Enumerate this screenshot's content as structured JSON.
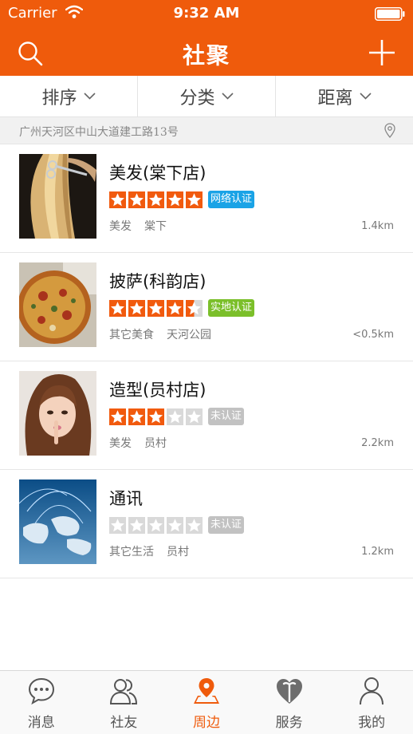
{
  "status_bar": {
    "carrier": "Carrier",
    "time": "9:32 AM"
  },
  "nav": {
    "title": "社聚",
    "left_icon": "search-icon",
    "right_icon": "add-icon"
  },
  "filters": [
    {
      "label": "排序",
      "icon": "chevron-down-icon"
    },
    {
      "label": "分类",
      "icon": "chevron-down-icon"
    },
    {
      "label": "距离",
      "icon": "chevron-down-icon"
    }
  ],
  "address": {
    "text": "广州天河区中山大道建工路13号",
    "icon": "location-pin-icon"
  },
  "colors": {
    "brand": "#ef5b0c",
    "star_on": "#f15a0e",
    "star_off": "#d9d9d9",
    "badge_network": "#1aa3e6",
    "badge_onsite": "#7bbf2a",
    "badge_none": "#c2c2c2"
  },
  "shops": [
    {
      "name": "美发(棠下店)",
      "rating": 5,
      "badge": "网络认证",
      "badge_type": "network",
      "category": "美发",
      "area": "棠下",
      "distance": "1.4km",
      "image": "hair-salon-photo"
    },
    {
      "name": "披萨(科韵店)",
      "rating": 4.5,
      "badge": "实地认证",
      "badge_type": "onsite",
      "category": "其它美食",
      "area": "天河公园",
      "distance": "<0.5km",
      "image": "pizza-photo"
    },
    {
      "name": "造型(员村店)",
      "rating": 3,
      "badge": "未认证",
      "badge_type": "none",
      "category": "美发",
      "area": "员村",
      "distance": "2.2km",
      "image": "portrait-photo"
    },
    {
      "name": "通讯",
      "rating": 0,
      "badge": "未认证",
      "badge_type": "none",
      "category": "其它生活",
      "area": "员村",
      "distance": "1.2km",
      "image": "world-map-photo"
    }
  ],
  "tabs": [
    {
      "label": "消息",
      "icon": "chat-bubble-icon",
      "active": false
    },
    {
      "label": "社友",
      "icon": "friends-icon",
      "active": false
    },
    {
      "label": "周边",
      "icon": "location-map-icon",
      "active": true
    },
    {
      "label": "服务",
      "icon": "heart-hands-icon",
      "active": false
    },
    {
      "label": "我的",
      "icon": "person-icon",
      "active": false
    }
  ]
}
